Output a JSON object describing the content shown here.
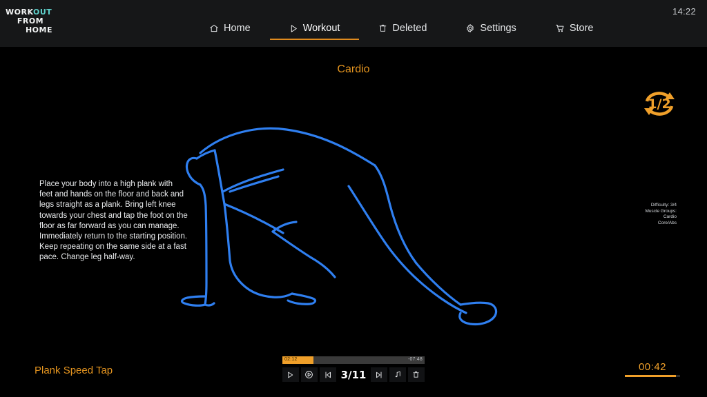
{
  "header": {
    "logo": {
      "line1_a": "WORK",
      "line1_b": "OUT",
      "line2": "FROM",
      "line3": "HOME",
      "teal": "#5fd2cc"
    },
    "clock": "14:22",
    "nav": [
      {
        "label": "Home",
        "icon": "home-icon",
        "active": false
      },
      {
        "label": "Workout",
        "icon": "play-icon",
        "active": true
      },
      {
        "label": "Deleted",
        "icon": "trash-icon",
        "active": false
      },
      {
        "label": "Settings",
        "icon": "gear-icon",
        "active": false
      },
      {
        "label": "Store",
        "icon": "cart-icon",
        "active": false
      }
    ]
  },
  "main": {
    "section_title": "Cardio",
    "repeat_badge": {
      "icon": "repeat-arrows-icon",
      "value": "1/2"
    },
    "instructions": "Place your body into a high plank with feet and hands on the floor and back and legs straight as a plank. Bring left knee towards your chest and tap the foot on the floor as far forward as you can manage. Immediately return to the starting position. Keep repeating on the same side at a fast pace. Change leg half-way.",
    "figure": {
      "icon": "plank-exercise-illustration",
      "stroke": "#2f7ff0"
    },
    "meta": {
      "difficulty": "Difficulty: 3/4",
      "muscle_groups_label": "Muscle Groups:",
      "group_1": "Cardio",
      "group_2": "Core/Abs"
    }
  },
  "footer": {
    "exercise_name": "Plank Speed Tap",
    "player": {
      "elapsed": "02:12",
      "remaining": "-07:48",
      "progress_percent": 22,
      "counter": "3/11",
      "controls": [
        {
          "name": "play-button",
          "icon": "play-icon"
        },
        {
          "name": "replay-button",
          "icon": "circled-play-icon"
        },
        {
          "name": "previous-button",
          "icon": "skip-back-icon"
        },
        {
          "name": "next-button",
          "icon": "skip-forward-icon"
        },
        {
          "name": "music-button",
          "icon": "music-note-icon"
        },
        {
          "name": "delete-button",
          "icon": "trash-icon"
        }
      ]
    },
    "timer": {
      "value": "00:42",
      "progress_percent": 92
    }
  },
  "colors": {
    "accent": "#e4941f",
    "accent_bright": "#f0a02a",
    "figure_blue": "#2f7ff0",
    "header_bg": "#161718"
  }
}
